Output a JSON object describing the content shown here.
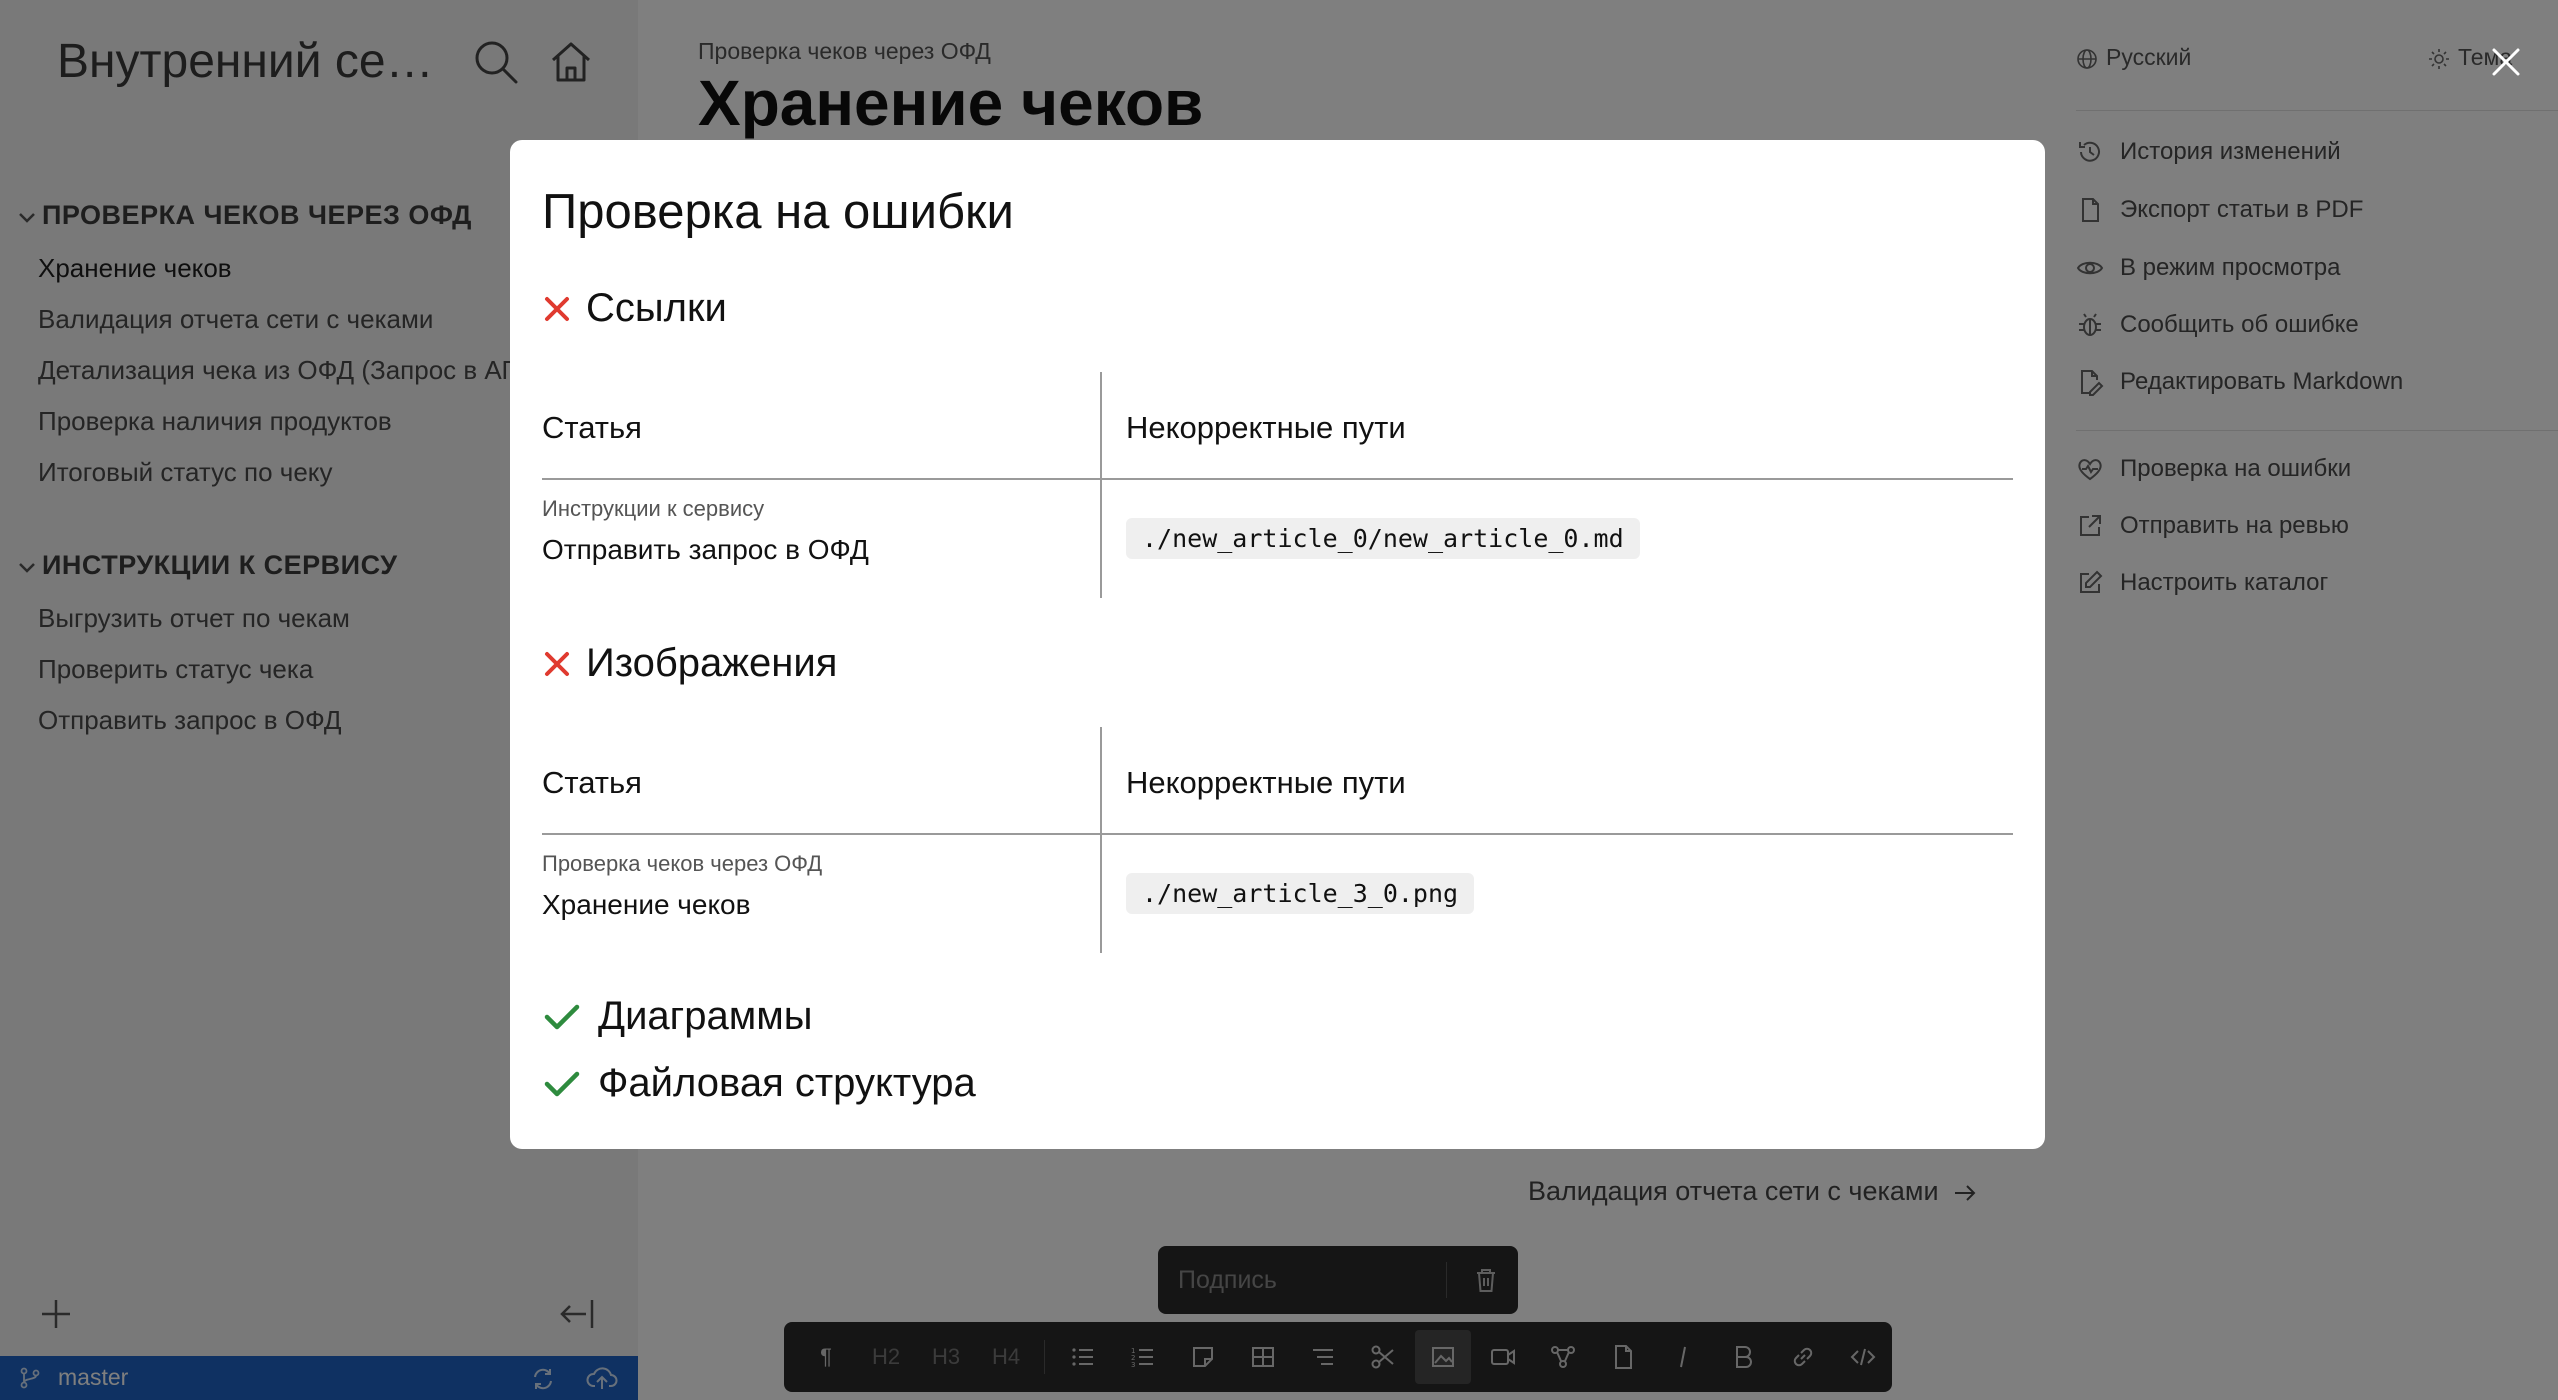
{
  "sidebar": {
    "title": "Внутренний серв...",
    "sections": [
      {
        "title": "ПРОВЕРКА ЧЕКОВ ЧЕРЕЗ ОФД",
        "items": [
          "Хранение чеков",
          "Валидация отчета сети с чеками",
          "Детализация чека из ОФД (Запрос в АПИ ОФД)",
          "Проверка наличия продуктов",
          "Итоговый статус по чеку"
        ]
      },
      {
        "title": "ИНСТРУКЦИИ К СЕРВИСУ",
        "items": [
          "Выгрузить отчет по чекам",
          "Проверить статус чека",
          "Отправить запрос в ОФД"
        ]
      }
    ],
    "branch": "master"
  },
  "main": {
    "breadcrumb": "Проверка чеков через ОФД",
    "title": "Хранение чеков",
    "next_link": "Валидация отчета сети с чеками"
  },
  "right_panel": {
    "language": "Русский",
    "theme": "Тема",
    "actions": [
      "История изменений",
      "Экспорт статьи в PDF",
      "В режим просмотра",
      "Сообщить об ошибке",
      "Редактировать Markdown"
    ],
    "actions2": [
      "Проверка на ошибки",
      "Отправить на ревью",
      "Настроить каталог"
    ]
  },
  "editor": {
    "caption_placeholder": "Подпись",
    "toolbar": {
      "h2": "H2",
      "h3": "H3",
      "h4": "H4"
    }
  },
  "modal": {
    "title": "Проверка на ошибки",
    "sections": [
      {
        "title": "Ссылки",
        "status": "error",
        "col_article": "Статья",
        "col_paths": "Некорректные пути",
        "rows": [
          {
            "parent": "Инструкции к сервису",
            "article": "Отправить запрос в ОФД",
            "path": "./new_article_0/new_article_0.md"
          }
        ]
      },
      {
        "title": "Изображения",
        "status": "error",
        "col_article": "Статья",
        "col_paths": "Некорректные пути",
        "rows": [
          {
            "parent": "Проверка чеков через ОФД",
            "article": "Хранение чеков",
            "path": "./new_article_3_0.png"
          }
        ]
      },
      {
        "title": "Диаграммы",
        "status": "ok"
      },
      {
        "title": "Файловая структура",
        "status": "ok"
      }
    ],
    "colors": {
      "error": "#e03a2f",
      "ok": "#2e8b3e"
    }
  }
}
